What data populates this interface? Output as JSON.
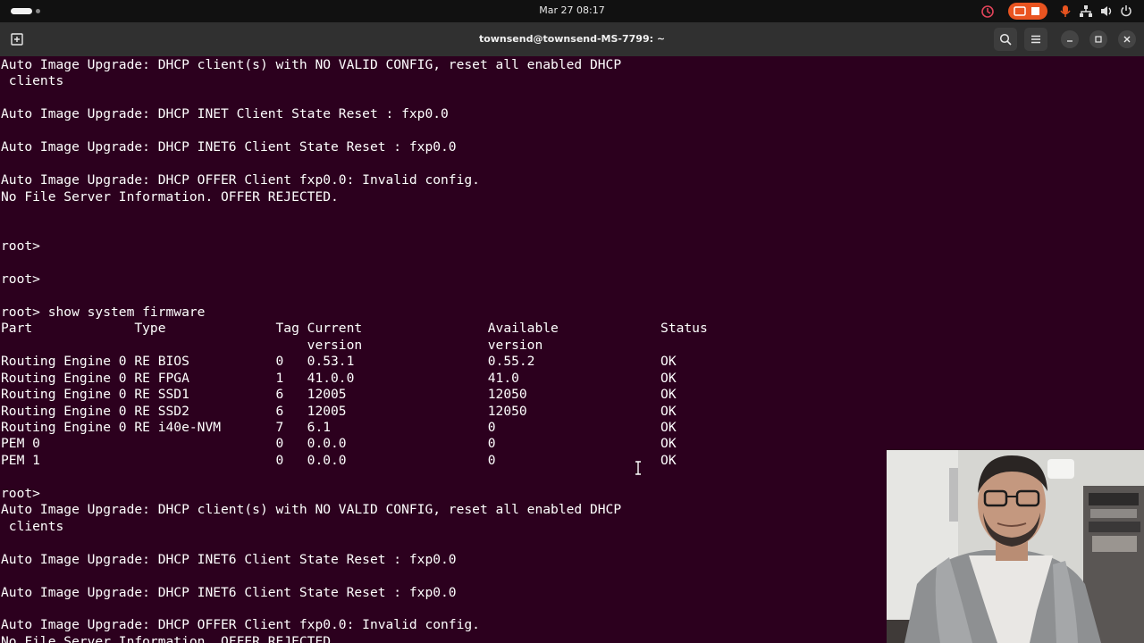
{
  "system_bar": {
    "clock": "Mar 27  08:17",
    "icons": [
      "activities-indicator",
      "update-icon",
      "screen-recording-icon",
      "microphone-icon",
      "network-icon",
      "volume-icon",
      "power-icon"
    ],
    "accent": "#e95420"
  },
  "window": {
    "title": "townsend@townsend-MS-7799: ~",
    "buttons": [
      "new-tab-icon",
      "search-icon",
      "menu-icon",
      "minimize-icon",
      "maximize-icon",
      "close-icon"
    ]
  },
  "terminal": {
    "background": "#2c001e",
    "foreground": "#ffffff",
    "lines": [
      "Auto Image Upgrade: DHCP client(s) with NO VALID CONFIG, reset all enabled DHCP",
      " clients",
      "",
      "Auto Image Upgrade: DHCP INET Client State Reset : fxp0.0",
      "",
      "Auto Image Upgrade: DHCP INET6 Client State Reset : fxp0.0",
      "",
      "Auto Image Upgrade: DHCP OFFER Client fxp0.0: Invalid config.",
      "No File Server Information. OFFER REJECTED.",
      "",
      "",
      "root>",
      "",
      "root>",
      "",
      "root> show system firmware",
      "Part             Type              Tag Current                Available             Status",
      "                                       version                version",
      "Routing Engine 0 RE BIOS           0   0.53.1                 0.55.2                OK",
      "Routing Engine 0 RE FPGA           1   41.0.0                 41.0                  OK",
      "Routing Engine 0 RE SSD1           6   12005                  12050                 OK",
      "Routing Engine 0 RE SSD2           6   12005                  12050                 OK",
      "Routing Engine 0 RE i40e-NVM       7   6.1                    0                     OK",
      "PEM 0                              0   0.0.0                  0                     OK",
      "PEM 1                              0   0.0.0                  0                     OK",
      "",
      "root>",
      "Auto Image Upgrade: DHCP client(s) with NO VALID CONFIG, reset all enabled DHCP",
      " clients",
      "",
      "Auto Image Upgrade: DHCP INET6 Client State Reset : fxp0.0",
      "",
      "Auto Image Upgrade: DHCP INET6 Client State Reset : fxp0.0",
      "",
      "Auto Image Upgrade: DHCP OFFER Client fxp0.0: Invalid config.",
      "No File Server Information. OFFER REJECTED."
    ]
  }
}
